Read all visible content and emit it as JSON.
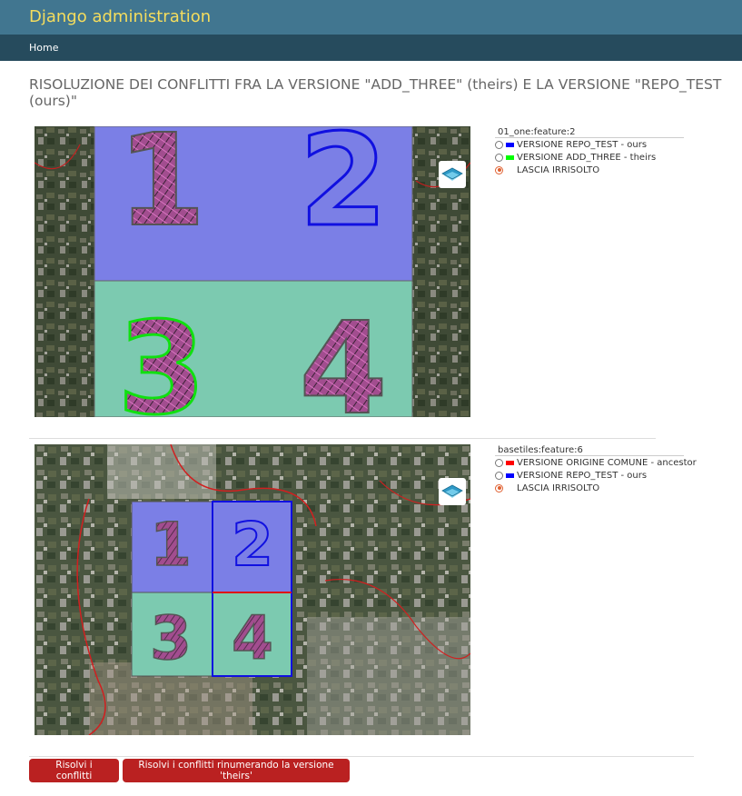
{
  "header": {
    "brand": "Django administration"
  },
  "breadcrumbs": {
    "home": "Home"
  },
  "page": {
    "title": "RISOLUZIONE DEI CONFLITTI FRA LA VERSIONE \"ADD_THREE\" (theirs) E LA VERSIONE \"REPO_TEST (ours)\""
  },
  "conflicts": [
    {
      "title": "01_one:feature:2",
      "options": [
        {
          "label": "VERSIONE REPO_TEST - ours",
          "color": "#0000ff",
          "selected": false
        },
        {
          "label": "VERSIONE ADD_THREE - theirs",
          "color": "#00ff00",
          "selected": false
        },
        {
          "label": "LASCIA IRRISOLTO",
          "color": "",
          "selected": true
        }
      ],
      "map": {
        "tiles": [
          "1",
          "2",
          "3",
          "4"
        ]
      }
    },
    {
      "title": "basetiles:feature:6",
      "options": [
        {
          "label": "VERSIONE ORIGINE COMUNE - ancestor",
          "color": "#ff0000",
          "selected": false
        },
        {
          "label": "VERSIONE REPO_TEST - ours",
          "color": "#0000ff",
          "selected": false
        },
        {
          "label": "LASCIA IRRISOLTO",
          "color": "",
          "selected": true
        }
      ],
      "map": {
        "tiles": [
          "1",
          "2",
          "3",
          "4"
        ]
      }
    }
  ],
  "actions": {
    "resolve": "Risolvi i conflitti",
    "resolve_renumber": "Risolvi i conflitti rinumerando la versione 'theirs'"
  },
  "colors": {
    "header": "#417690",
    "breadcrumbs": "#264b5d",
    "brand": "#f5dd5d",
    "button": "#ba2121",
    "tile_blue": "#7b7fe6",
    "tile_green": "#7ccab0"
  }
}
